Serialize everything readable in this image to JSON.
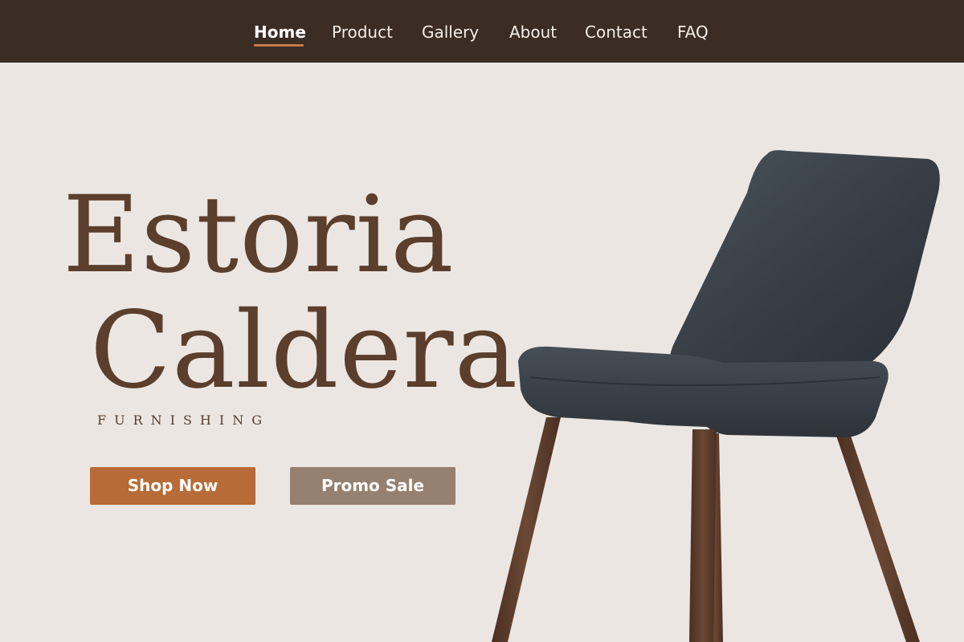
{
  "nav": {
    "items": [
      {
        "label": "Home",
        "active": true
      },
      {
        "label": "Product",
        "active": false
      },
      {
        "label": "Gallery",
        "active": false
      },
      {
        "label": "About",
        "active": false
      },
      {
        "label": "Contact",
        "active": false
      },
      {
        "label": "FAQ",
        "active": false
      }
    ]
  },
  "hero": {
    "brand_line_1": "Estoria",
    "brand_line_2": "Caldera",
    "brand_sub": "FURNISHING",
    "shop_button": "Shop Now",
    "promo_button": "Promo Sale"
  },
  "colors": {
    "nav_background": "#3b2c24",
    "page_background": "#ebe6e2",
    "brand_text": "#5b3e2b",
    "accent": "#c47b46",
    "shop_button": "#b76b36",
    "promo_button": "#968070",
    "chair_fabric": "#3a4249",
    "chair_legs": "#5a3a2a"
  }
}
